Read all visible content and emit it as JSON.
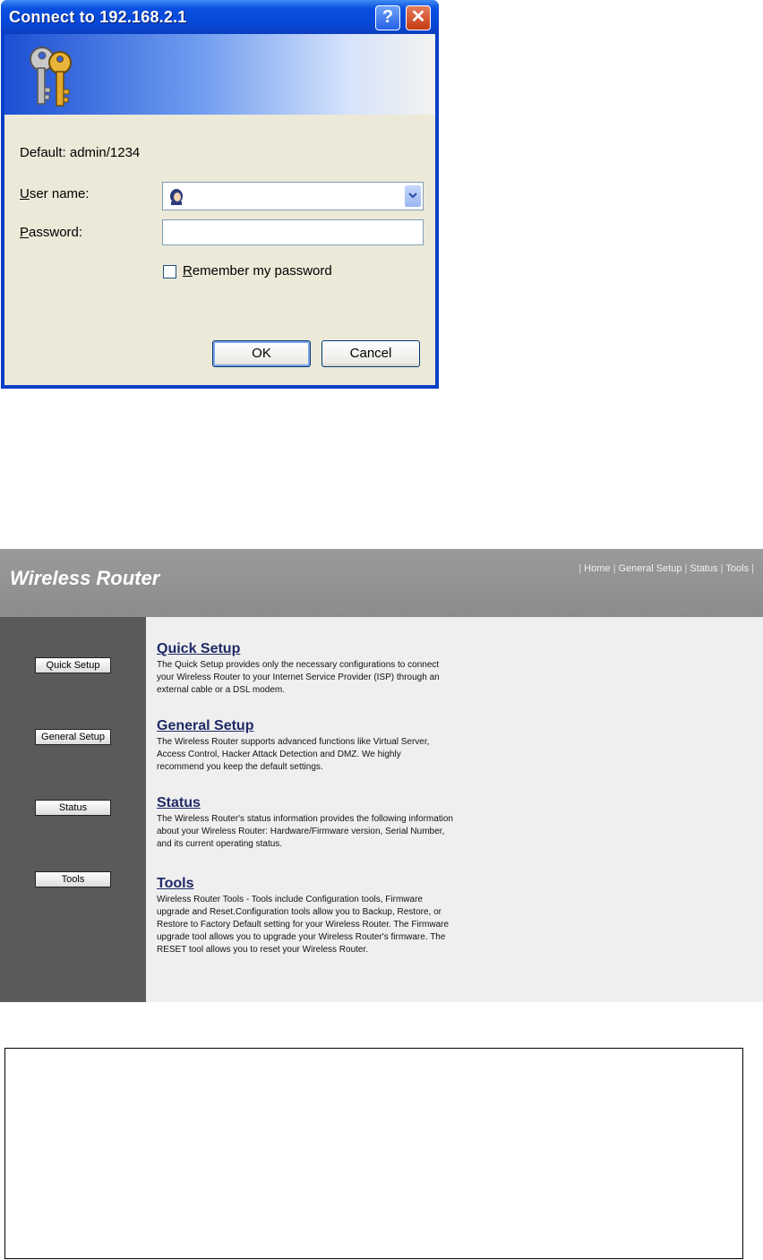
{
  "dialog": {
    "title": "Connect to 192.168.2.1",
    "help_label": "?",
    "close_label": "✕",
    "default_text": "Default: admin/1234",
    "username_label_u": "U",
    "username_label_rest": "ser name:",
    "username_value": "",
    "password_label_u": "P",
    "password_label_rest": "assword:",
    "password_value": "",
    "remember_label_u": "R",
    "remember_label_rest": "emember my password",
    "remember_checked": false,
    "ok_label": "OK",
    "cancel_label": "Cancel"
  },
  "router": {
    "logo": "Wireless Router",
    "topnav": {
      "home": "Home",
      "general_setup": "General Setup",
      "status": "Status",
      "tools": "Tools"
    },
    "sidebar": [
      {
        "label": "Quick Setup"
      },
      {
        "label": "General Setup"
      },
      {
        "label": "Status"
      },
      {
        "label": "Tools"
      }
    ],
    "sections": [
      {
        "title": "Quick Setup",
        "line1": "The Quick Setup provides only the necessary configurations to connect",
        "line2": "your Wireless Router to your Internet Service Provider (ISP) through an",
        "line3": "external cable or a DSL modem.",
        "line4": "",
        "line5": ""
      },
      {
        "title": "General Setup",
        "line1": "The Wireless Router supports advanced functions like Virtual Server,",
        "line2": "Access Control, Hacker Attack Detection and DMZ. We highly",
        "line3": "recommend you keep the default settings.",
        "line4": "",
        "line5": ""
      },
      {
        "title": "Status",
        "line1": "The Wireless Router's status information provides the following information",
        "line2": "about your Wireless Router: Hardware/Firmware version, Serial Number,",
        "line3": "and its current operating status.",
        "line4": "",
        "line5": ""
      },
      {
        "title": "Tools",
        "line1": "Wireless Router Tools - Tools include Configuration tools, Firmware",
        "line2": "upgrade and Reset.Configuration tools allow you to Backup, Restore, or",
        "line3": "Restore to Factory Default setting for your Wireless Router. The Firmware",
        "line4": "upgrade tool allows you to upgrade your Wireless Router's firmware. The",
        "line5": "RESET tool allows you to reset your Wireless Router."
      }
    ]
  },
  "colors": {
    "titlebar": "#0a4fe0",
    "dialog_body": "#ece9d8",
    "router_header": "#8c8c8c",
    "router_sidebar": "#5a5a5a",
    "router_main": "#efefef",
    "section_title": "#1f2a66"
  },
  "icons": [
    "keys-icon",
    "help-icon",
    "close-icon",
    "user-avatar-icon",
    "dropdown-arrow-icon"
  ]
}
